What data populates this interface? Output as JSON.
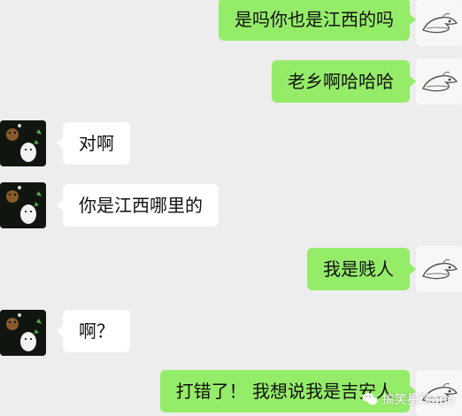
{
  "messages": [
    {
      "side": "right",
      "text": "是吗你也是江西的吗"
    },
    {
      "side": "right",
      "text": "老乡啊哈哈哈"
    },
    {
      "side": "left",
      "text": "对啊"
    },
    {
      "side": "left",
      "text": "你是江西哪里的"
    },
    {
      "side": "right",
      "text": "我是贱人"
    },
    {
      "side": "left",
      "text": "啊？"
    },
    {
      "side": "right",
      "text": "打错了！ 我想说我是吉安人"
    }
  ],
  "watermark": {
    "text": "搞笑星球app"
  },
  "icons": {
    "self_avatar": "dragon-sketch-avatar",
    "contact_avatar": "cartoon-bear-avatar",
    "watermark": "wechat-icon"
  },
  "colors": {
    "chat_background": "#ededed",
    "outgoing_bubble": "#95ec69",
    "incoming_bubble": "#ffffff"
  }
}
